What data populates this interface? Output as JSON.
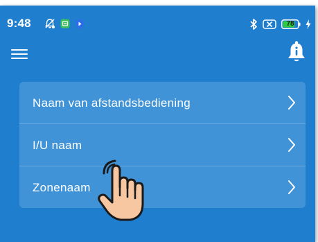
{
  "status_bar": {
    "time": "9:48",
    "battery_level": "78",
    "icons_left": [
      "muted-alarm-icon",
      "app-notification-icon",
      "shield-icon"
    ],
    "icons_right": [
      "bluetooth-icon",
      "no-sim-icon",
      "battery-icon",
      "charging-icon"
    ]
  },
  "app_bar": {
    "icons": [
      "hamburger-menu-icon",
      "notification-bell-icon"
    ]
  },
  "settings_list": {
    "items": [
      {
        "label": "Naam van afstandsbediening"
      },
      {
        "label": "I/U naam"
      },
      {
        "label": "Zonenaam"
      }
    ]
  },
  "overlay": {
    "icon": "tap-hand-icon"
  },
  "colors": {
    "background": "#1f7fce",
    "card": "#4193d8",
    "divider": "#6aaae2",
    "text": "#ffffff",
    "hand_fill": "#f6c7a0",
    "hand_outline": "#1a1a1a",
    "battery": "#2ecc40"
  }
}
